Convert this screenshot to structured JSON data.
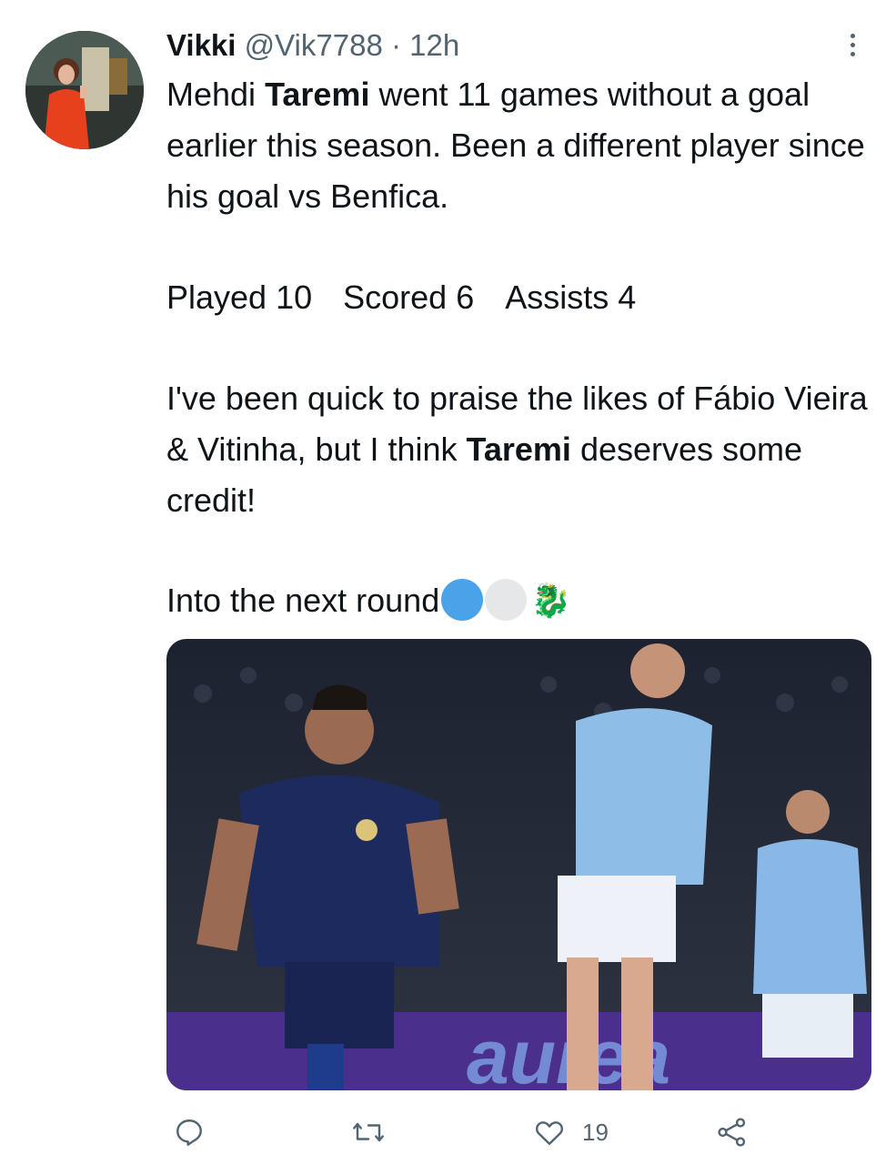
{
  "tweet": {
    "author_name": "Vikki",
    "author_handle": "@Vik7788",
    "separator": " · ",
    "timestamp": "12h",
    "p1_pre": "Mehdi ",
    "p1_bold": "Taremi",
    "p1_post": " went 11 games without a goal earlier this season. Been a different player since his goal vs Benfica.",
    "stats": [
      "Played 10",
      "Scored 6",
      "Assists 4"
    ],
    "p3_pre": "I've been quick to praise the likes of Fábio Vieira & Vitinha, but I think ",
    "p3_bold": "Taremi",
    "p3_post": " deserves some credit!",
    "p4_text": "Into the next round",
    "emoji_dot1_color": "#4aa3e8",
    "emoji_dot2_color": "#e6e7e9",
    "emoji_dragon": "🐉",
    "image_banner_text": "aurea"
  },
  "actions": {
    "reply_icon": "reply-icon",
    "retweet_icon": "retweet-icon",
    "like_icon": "heart-icon",
    "like_count": "19",
    "share_icon": "share-icon"
  },
  "colors": {
    "text_primary": "#0f1419",
    "text_secondary": "#536471"
  }
}
